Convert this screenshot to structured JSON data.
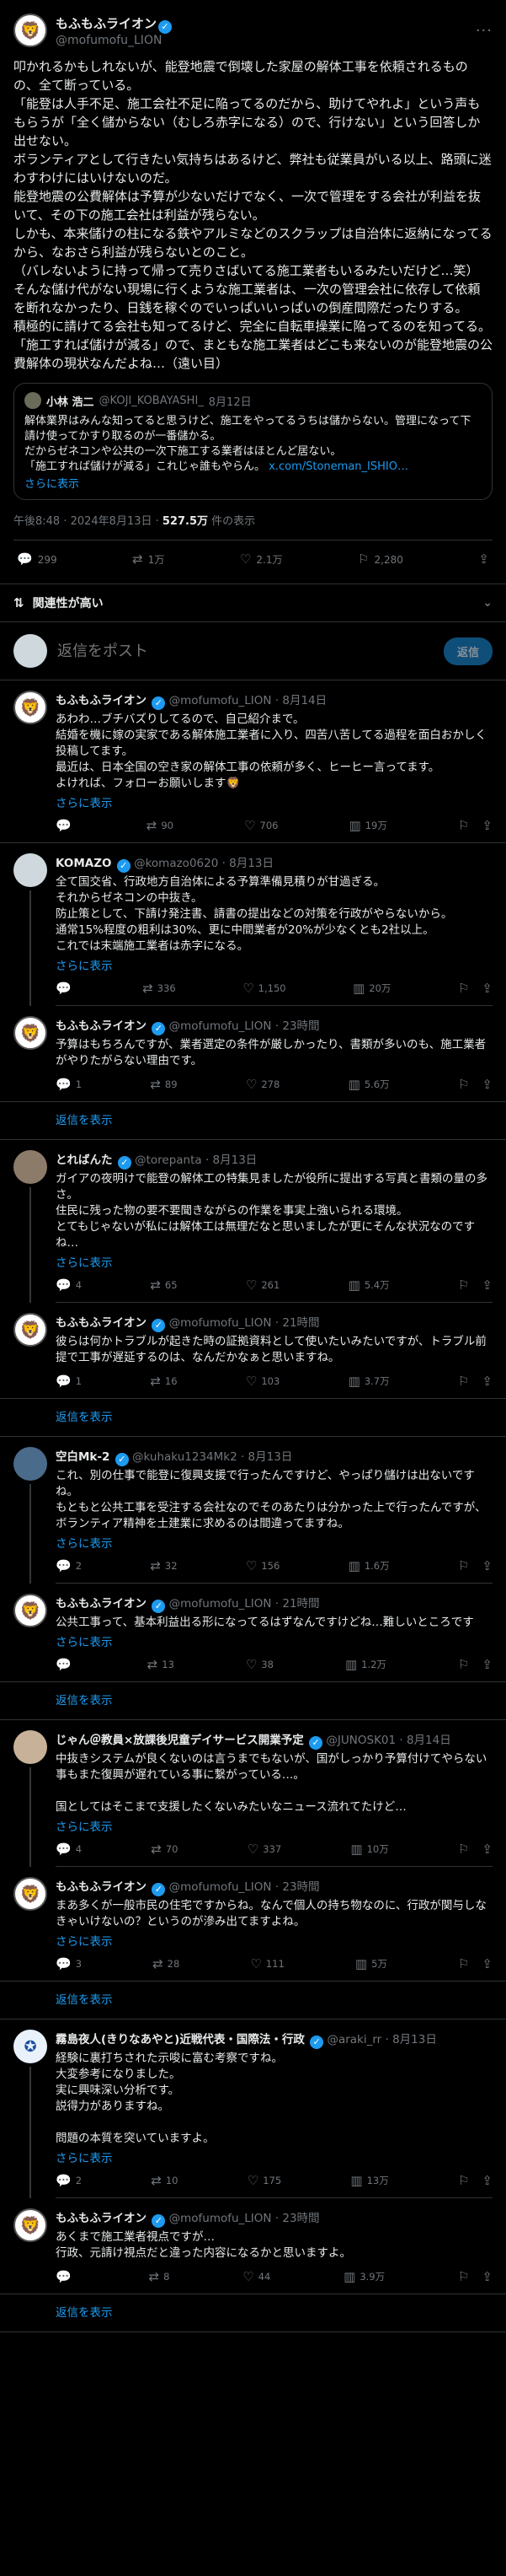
{
  "main": {
    "author": "もふもふライオン",
    "handle": "@mofumofu_LION",
    "text": "叩かれるかもしれないが、能登地震で倒壊した家屋の解体工事を依頼されるものの、全て断っている。\n「能登は人手不足、施工会社不足に陥ってるのだから、助けてやれよ」という声ももらうが「全く儲からない（むしろ赤字になる）ので、行けない」という回答しか出せない。\nボランティアとして行きたい気持ちはあるけど、弊社も従業員がいる以上、路頭に迷わすわけにはいけないのだ。\n能登地震の公費解体は予算が少ないだけでなく、一次で管理をする会社が利益を抜いて、その下の施工会社は利益が残らない。\nしかも、本来儲けの柱になる鉄やアルミなどのスクラップは自治体に返納になってるから、なおさら利益が残らないとのこと。\n（バレないように持って帰って売りさばいてる施工業者もいるみたいだけど…笑）\nそんな儲け代がない現場に行くような施工業者は、一次の管理会社に依存して依頼を断れなかったり、日銭を稼ぐのでいっぱいいっぱいの倒産間際だったりする。\n積極的に請けてる会社も知ってるけど、完全に自転車操業に陥ってるのを知ってる。\n「施工すれば儲けが減る」ので、まともな施工業者はどこも来ないのが能登地震の公費解体の現状なんだよね…（遠い目）",
    "quote": {
      "author": "小林 浩二",
      "handle": "@KOJI_KOBAYASHI_",
      "date": "8月12日",
      "text": "解体業界はみんな知ってると思うけど、施工をやってるうちは儲からない。管理になって下請け使ってかすり取るのが一番儲かる。\nだからゼネコンや公共の一次下施工する業者はほとんど居ない。\n「施工すれば儲けが減る」これじゃ誰もやらん。",
      "link": "x.com/Stoneman_ISHIO…",
      "show_more": "さらに表示"
    },
    "time": "午後8:48 · 2024年8月13日 · ",
    "views": "527.5万",
    "views_suffix": " 件の表示",
    "stats": {
      "replies": "299",
      "reposts": "1万",
      "likes": "2.1万",
      "bookmarks": "2,280"
    }
  },
  "sort_label": "関連性が高い",
  "compose": {
    "placeholder": "返信をポスト",
    "button": "返信"
  },
  "replies": [
    {
      "author": "もふもふライオン",
      "handle": "@mofumofu_LION · 8月14日",
      "text": "あわわ…ブチバズりしてるので、自己紹介まで。\n結婚を機に嫁の実家である解体施工業者に入り、四苦八苦してる過程を面白おかしく投稿してます。\n最近は、日本全国の空き家の解体工事の依頼が多く、ヒーヒー言ってます。\nよければ、フォローお願いします🦁",
      "more": "さらに表示",
      "replies": "",
      "reposts": "90",
      "likes": "706",
      "views": "19万",
      "avatar": "lion"
    },
    {
      "author": "KOMAZO",
      "handle": "@komazo0620 · 8月13日",
      "text": "全て国交省、行政地方自治体による予算準備見積りが甘過ぎる。\nそれからゼネコンの中抜き。\n防止策として、下請け発注書、請書の提出などの対策を行政がやらないから。\n通常15%程度の粗利は30%、更に中間業者が20%が少なくとも2社以上。\nこれでは末端施工業者は赤字になる。",
      "more": "さらに表示",
      "replies": "",
      "reposts": "336",
      "likes": "1,150",
      "views": "20万",
      "avatar": "ph"
    },
    {
      "author": "もふもふライオン",
      "handle": "@mofumofu_LION · 23時間",
      "text": "予算はもちろんですが、業者選定の条件が厳しかったり、書類が多いのも、施工業者がやりたがらない理由です。",
      "more": "",
      "replies": "1",
      "reposts": "89",
      "likes": "278",
      "views": "5.6万",
      "avatar": "lion"
    },
    {
      "author": "とればんた",
      "handle": "@torepanta · 8月13日",
      "text": "ガイアの夜明けで能登の解体工の特集見ましたが役所に提出する写真と書類の量の多さ。\n住民に残った物の要不要聞きながらの作業を事実上強いられる環境。\nとてもじゃないが私には解体工は無理だなと思いましたが更にそんな状況なのですね…",
      "more": "さらに表示",
      "replies": "4",
      "reposts": "65",
      "likes": "261",
      "views": "5.4万",
      "avatar": "ph2"
    },
    {
      "author": "もふもふライオン",
      "handle": "@mofumofu_LION · 21時間",
      "text": "彼らは何かトラブルが起きた時の証拠資料として使いたいみたいですが、トラブル前提で工事が遅延するのは、なんだかなぁと思いますね。",
      "more": "",
      "replies": "1",
      "reposts": "16",
      "likes": "103",
      "views": "3.7万",
      "avatar": "lion"
    },
    {
      "author": "空白Mk-2",
      "handle": "@kuhaku1234Mk2 · 8月13日",
      "text": "これ、別の仕事で能登に復興支援で行ったんですけど、やっぱり儲けは出ないですね。\nもともと公共工事を受注する会社なのでそのあたりは分かった上で行ったんですが、ボランティア精神を土建業に求めるのは間違ってますね。",
      "more": "さらに表示",
      "replies": "2",
      "reposts": "32",
      "likes": "156",
      "views": "1.6万",
      "avatar": "ph3"
    },
    {
      "author": "もふもふライオン",
      "handle": "@mofumofu_LION · 21時間",
      "text": "公共工事って、基本利益出る形になってるはずなんですけどね…難しいところです",
      "more": "さらに表示",
      "replies": "",
      "reposts": "13",
      "likes": "38",
      "views": "1.2万",
      "avatar": "lion"
    },
    {
      "author": "じゃん＠教員×放課後児童デイサービス開業予定",
      "handle": "@JUNOSK01 · 8月14日",
      "text": "中抜きシステムが良くないのは言うまでもないが、国がしっかり予算付けてやらない事もまた復興が遅れている事に繋がっている…。\n\n国としてはそこまで支援したくないみたいなニュース流れてたけど…",
      "more": "さらに表示",
      "replies": "4",
      "reposts": "70",
      "likes": "337",
      "views": "10万",
      "avatar": "ph4"
    },
    {
      "author": "もふもふライオン",
      "handle": "@mofumofu_LION · 23時間",
      "text": "まあ多くが一般市民の住宅ですからね。なんで個人の持ち物なのに、行政が関与しなきゃいけないの？というのが滲み出てますよね。",
      "more": "さらに表示",
      "replies": "3",
      "reposts": "28",
      "likes": "111",
      "views": "5万",
      "avatar": "lion"
    },
    {
      "author": "霧島夜人(きりなあやと)近戦代表・国際法・行政",
      "handle": "@araki_rr · 8月13日",
      "text": "経験に裏打ちされた示唆に富む考察ですね。\n大変参考になりました。\n実に興味深い分析です。\n説得力がありますね。\n\n問題の本質を突いていますよ。",
      "more": "さらに表示",
      "replies": "2",
      "reposts": "10",
      "likes": "175",
      "views": "13万",
      "avatar": "ph5"
    },
    {
      "author": "もふもふライオン",
      "handle": "@mofumofu_LION · 23時間",
      "text": "あくまで施工業者視点ですが…\n行政、元請け視点だと違った内容になるかと思いますよ。",
      "more": "",
      "replies": "",
      "reposts": "8",
      "likes": "44",
      "views": "3.9万",
      "avatar": "lion"
    }
  ],
  "show_replies": "返信を表示",
  "colors": {
    "accent": "#1d9bf0",
    "bg": "#000000",
    "muted": "#71767b"
  }
}
